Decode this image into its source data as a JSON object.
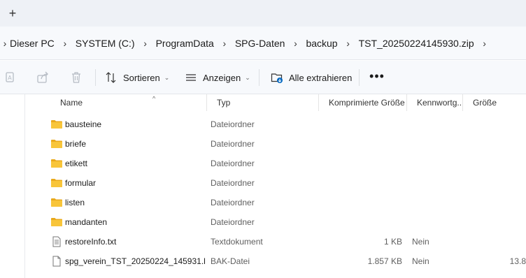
{
  "tabbar": {
    "new_tab_glyph": "+"
  },
  "breadcrumb": [
    "Dieser PC",
    "SYSTEM (C:)",
    "ProgramData",
    "SPG-Daten",
    "backup",
    "TST_20250224145930.zip"
  ],
  "toolbar": {
    "icons": [
      "copy-path-icon",
      "share-icon",
      "delete-icon"
    ],
    "sort_label": "Sortieren",
    "view_label": "Anzeigen",
    "extract_label": "Alle extrahieren",
    "more_label": "•••"
  },
  "columns": {
    "name": "Name",
    "type": "Typ",
    "compressed": "Komprimierte Größe",
    "password": "Kennwortg...",
    "size": "Größe"
  },
  "files": [
    {
      "name": "bausteine",
      "type": "Dateiordner",
      "compressed": "",
      "password": "",
      "size": "",
      "icon": "folder-icon"
    },
    {
      "name": "briefe",
      "type": "Dateiordner",
      "compressed": "",
      "password": "",
      "size": "",
      "icon": "folder-icon"
    },
    {
      "name": "etikett",
      "type": "Dateiordner",
      "compressed": "",
      "password": "",
      "size": "",
      "icon": "folder-icon"
    },
    {
      "name": "formular",
      "type": "Dateiordner",
      "compressed": "",
      "password": "",
      "size": "",
      "icon": "folder-icon"
    },
    {
      "name": "listen",
      "type": "Dateiordner",
      "compressed": "",
      "password": "",
      "size": "",
      "icon": "folder-icon"
    },
    {
      "name": "mandanten",
      "type": "Dateiordner",
      "compressed": "",
      "password": "",
      "size": "",
      "icon": "folder-icon"
    },
    {
      "name": "restoreInfo.txt",
      "type": "Textdokument",
      "compressed": "1 KB",
      "password": "Nein",
      "size": "",
      "icon": "text-file-icon"
    },
    {
      "name": "spg_verein_TST_20250224_145931.b...",
      "type": "BAK-Datei",
      "compressed": "1.857 KB",
      "password": "Nein",
      "size": "13.8",
      "icon": "file-icon"
    }
  ],
  "colors": {
    "folder": "#f8c53a",
    "accent": "#0067c0"
  }
}
